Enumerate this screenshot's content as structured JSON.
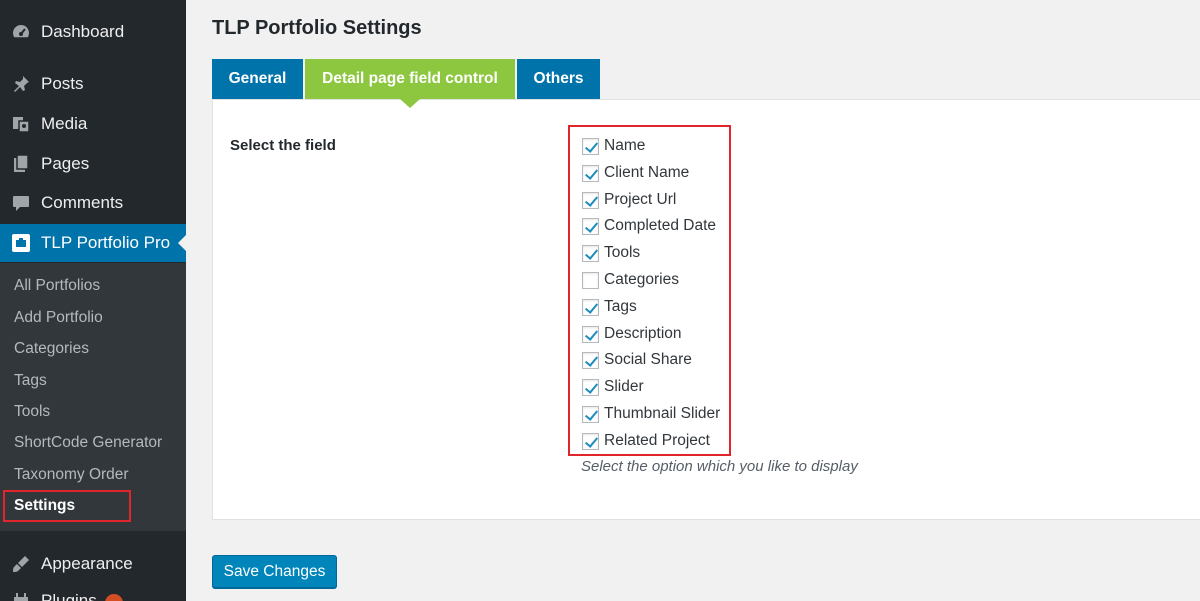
{
  "sidebar": {
    "items": [
      {
        "label": "Dashboard",
        "icon": "dashboard-icon"
      },
      {
        "label": "Posts",
        "icon": "pushpin-icon"
      },
      {
        "label": "Media",
        "icon": "media-icon"
      },
      {
        "label": "Pages",
        "icon": "pages-icon"
      },
      {
        "label": "Comments",
        "icon": "comment-icon"
      },
      {
        "label": "TLP Portfolio Pro",
        "icon": "portfolio-icon"
      },
      {
        "label": "Appearance",
        "icon": "paintbrush-icon"
      },
      {
        "label": "Plugins",
        "icon": "plugin-icon"
      }
    ],
    "submenu": [
      "All Portfolios",
      "Add Portfolio",
      "Categories",
      "Tags",
      "Tools",
      "ShortCode Generator",
      "Taxonomy Order",
      "Settings"
    ],
    "current_submenu": "Settings",
    "colors": {
      "background": "#23282d",
      "submenu": "#32373c",
      "active": "#0073aa"
    }
  },
  "page": {
    "title": "TLP Portfolio Settings",
    "tabs": [
      {
        "label": "General",
        "active": false
      },
      {
        "label": "Detail page field control",
        "active": true
      },
      {
        "label": "Others",
        "active": false
      }
    ],
    "field_label": "Select the field",
    "fields": [
      {
        "label": "Name",
        "checked": true
      },
      {
        "label": "Client Name",
        "checked": true
      },
      {
        "label": "Project Url",
        "checked": true
      },
      {
        "label": "Completed Date",
        "checked": true
      },
      {
        "label": "Tools",
        "checked": true
      },
      {
        "label": "Categories",
        "checked": false
      },
      {
        "label": "Tags",
        "checked": true
      },
      {
        "label": "Description",
        "checked": true
      },
      {
        "label": "Social Share",
        "checked": true
      },
      {
        "label": "Slider",
        "checked": true
      },
      {
        "label": "Thumbnail Slider",
        "checked": true
      },
      {
        "label": "Related Project",
        "checked": true
      }
    ],
    "hint": "Select the option which you like to display",
    "save_label": "Save Changes",
    "colors": {
      "tab_blue": "#0073aa",
      "tab_green": "#8dc63f",
      "highlight": "#e0262b",
      "button": "#0085ba"
    }
  }
}
